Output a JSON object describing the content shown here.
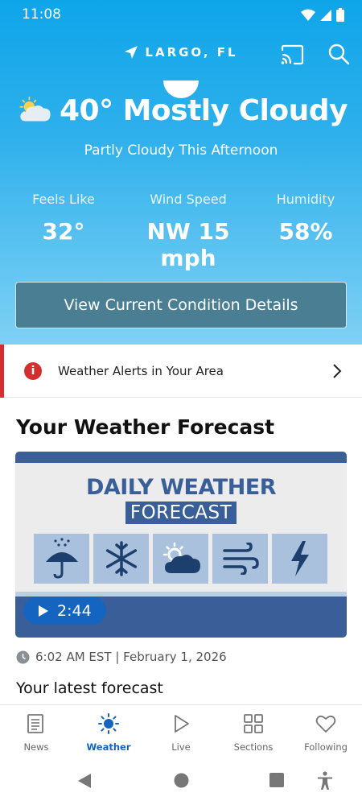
{
  "status_bar": {
    "time": "11:08"
  },
  "header": {
    "location": "LARGO, FL"
  },
  "current": {
    "condition": "40° Mostly Cloudy",
    "subtitle": "Partly Cloudy This Afternoon",
    "stats": [
      {
        "label": "Feels Like",
        "value": "32°"
      },
      {
        "label": "Wind Speed",
        "value": "NW 15 mph"
      },
      {
        "label": "Humidity",
        "value": "58%"
      }
    ],
    "details_button": "View Current Condition Details"
  },
  "alert": {
    "text": "Weather Alerts in Your Area"
  },
  "forecast": {
    "section_title": "Your Weather Forecast",
    "video": {
      "title_line1": "DAILY WEATHER",
      "title_line2": "FORECAST",
      "duration": "2:44",
      "tile_icons": [
        "umbrella-rain-icon",
        "snowflake-icon",
        "partly-cloudy-icon",
        "wind-icon",
        "lightning-icon"
      ]
    },
    "timestamp": "6:02 AM EST | February 1, 2026",
    "latest_label": "Your latest forecast"
  },
  "bottom_nav": {
    "items": [
      {
        "label": "News",
        "icon": "news-icon",
        "active": false
      },
      {
        "label": "Weather",
        "icon": "sun-icon",
        "active": true
      },
      {
        "label": "Live",
        "icon": "play-icon",
        "active": false
      },
      {
        "label": "Sections",
        "icon": "grid-icon",
        "active": false
      },
      {
        "label": "Following",
        "icon": "heart-icon",
        "active": false
      }
    ]
  },
  "colors": {
    "accent": "#1565c0",
    "alert": "#d32f2f",
    "video_blue": "#3a5e98",
    "button_bg": "#4a7e93"
  }
}
